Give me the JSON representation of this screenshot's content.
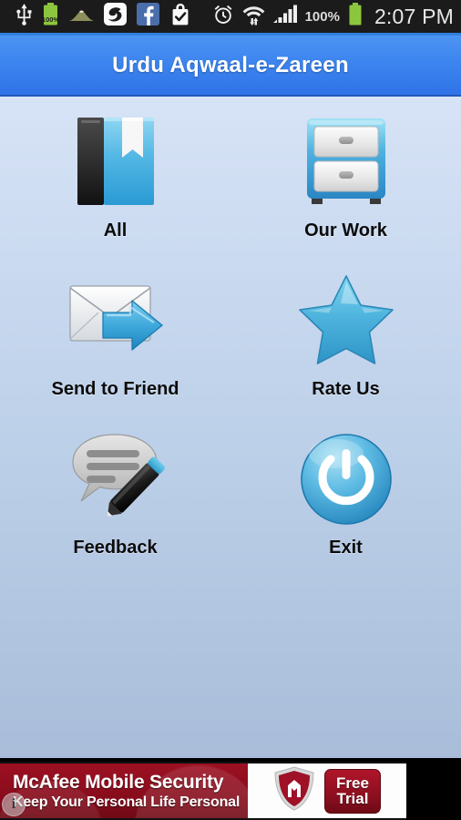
{
  "status_bar": {
    "icons": [
      "usb-icon",
      "battery-charging-icon",
      "mountain-icon",
      "app-circle-icon",
      "facebook-icon",
      "shopping-bag-check-icon"
    ],
    "battery_small_label": "100%",
    "right_icons": [
      "alarm-clock-icon",
      "wifi-transfer-icon",
      "signal-bars-icon"
    ],
    "battery_percent": "100%",
    "time": "2:07 PM",
    "background_color": "#1b1b1b",
    "accent_underline_color": "#2f7fe0"
  },
  "title_bar": {
    "title": "Urdu Aqwaal-e-Zareen",
    "background_color": "#3d85ef",
    "text_color": "#ffffff"
  },
  "menu": {
    "items": [
      {
        "label": "All",
        "icon": "book-bookmark-icon"
      },
      {
        "label": "Our Work",
        "icon": "file-cabinet-icon"
      },
      {
        "label": "Send to Friend",
        "icon": "envelope-arrow-icon"
      },
      {
        "label": "Rate Us",
        "icon": "star-icon"
      },
      {
        "label": "Feedback",
        "icon": "speech-bubble-pencil-icon"
      },
      {
        "label": "Exit",
        "icon": "power-button-icon"
      }
    ],
    "background_gradient_top": "#d7e3f6",
    "background_gradient_bottom": "#a9bdda",
    "label_color": "#0b0b0b"
  },
  "ad_banner": {
    "title": "McAfee Mobile Security",
    "subtitle": "Keep Your Personal Life Personal",
    "logo": "mcafee-shield-icon",
    "logo_letter": "M",
    "cta_line1": "Free",
    "cta_line2": "Trial",
    "info_badge": "i",
    "red_color": "#8a0d1d",
    "white_color": "#fdfdfd"
  }
}
